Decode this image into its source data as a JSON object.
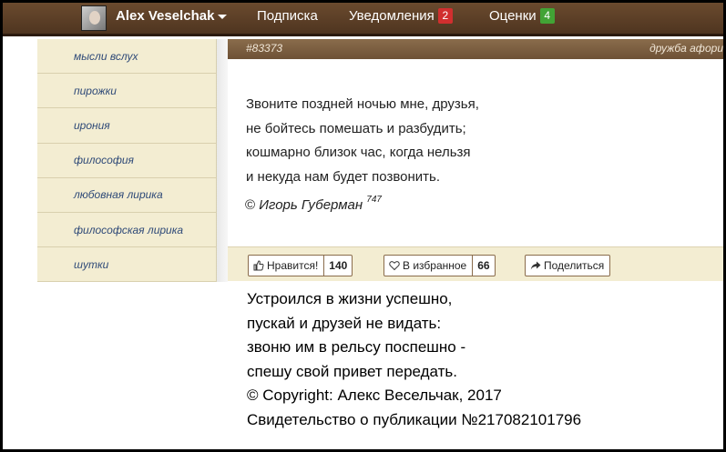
{
  "nav": {
    "user_name": "Alex Veselchak",
    "subscription": "Подписка",
    "notifications": "Уведомления",
    "notifications_count": "2",
    "ratings": "Оценки",
    "ratings_count": "4",
    "bar_color": "#5d412a",
    "badge_red": "#d12f2f",
    "badge_green": "#42a335"
  },
  "sidebar": {
    "items": [
      {
        "label": "мысли вслух"
      },
      {
        "label": "пирожки"
      },
      {
        "label": "ирония"
      },
      {
        "label": "философия"
      },
      {
        "label": "любовная лирика"
      },
      {
        "label": "философская лирика"
      },
      {
        "label": "шутки"
      }
    ]
  },
  "post": {
    "id": "#83373",
    "tags": "дружба   афори",
    "lines": [
      "Звоните поздней ночью мне, друзья,",
      "не бойтесь помешать и разбудить;",
      "кошмарно близок час, когда нельзя",
      "и некуда нам будет позвонить."
    ],
    "copyright_sign": "©",
    "author": "Игорь Губерман",
    "author_count": "747"
  },
  "actions": {
    "like_label": "Нравится!",
    "like_count": "140",
    "fav_label": "В избранное",
    "fav_count": "66",
    "share_label": "Поделиться"
  },
  "appended": {
    "lines": [
      "Устроился в жизни успешно,",
      "пускай и друзей не видать:",
      "звоню им в рельсу поспешно -",
      "спешу свой привет передать.",
      "© Copyright: Алекс Весельчак, 2017",
      "Свидетельство о публикации №217082101796"
    ]
  }
}
